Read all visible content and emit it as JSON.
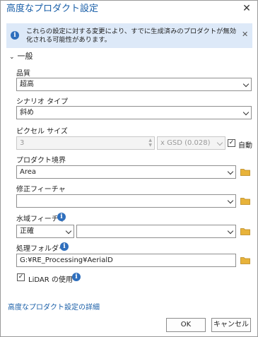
{
  "dialog": {
    "title": "高度なプロダクト設定",
    "close_glyph": "✕"
  },
  "banner": {
    "message": "これらの設定に対する変更により、すでに生成済みのプロダクトが無効化される可能性があります。",
    "close_glyph": "✕",
    "info_glyph": "i"
  },
  "section": {
    "label": "一般",
    "chevron": "⌄"
  },
  "quality": {
    "label": "品質",
    "value": "超高"
  },
  "scenario": {
    "label": "シナリオ タイプ",
    "value": "斜め"
  },
  "pixel_size": {
    "label": "ピクセル サイズ",
    "value": "3",
    "unit_value": "x GSD (0.028)",
    "auto_label": "自動",
    "auto_checked": true
  },
  "boundary": {
    "label": "プロダクト境界",
    "value": "Area"
  },
  "correction": {
    "label": "修正フィーチャ",
    "value": ""
  },
  "water": {
    "label": "水域フィーチャ",
    "mode_value": "正確",
    "value": ""
  },
  "processing": {
    "label": "処理フォルダー",
    "value": "G:¥RE_Processing¥AerialD"
  },
  "lidar": {
    "label": "LiDAR の使用",
    "checked": true
  },
  "details_link": "高度なプロダクト設定の詳細",
  "buttons": {
    "ok": "OK",
    "cancel": "キャンセル"
  },
  "colors": {
    "accent": "#1a5fa8",
    "info_blue": "#2f6fbd",
    "banner_bg": "#dde9f8",
    "folder_yellow": "#e8b33a"
  }
}
